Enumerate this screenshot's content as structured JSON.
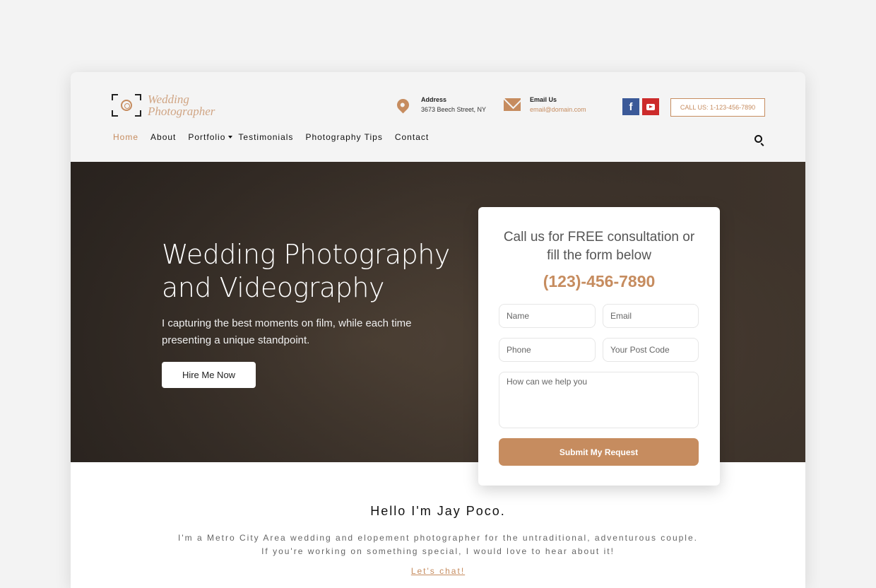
{
  "brand": {
    "line1": "Wedding",
    "line2": "Photographer"
  },
  "contact": {
    "address_title": "Address",
    "address": "3673 Beech Street, NY",
    "email_title": "Email Us",
    "email": "email@domain.com",
    "call_button": "CALL US: 1-123-456-7890"
  },
  "social": [
    {
      "icon": "facebook-icon",
      "label": "f"
    },
    {
      "icon": "youtube-icon"
    }
  ],
  "nav": [
    {
      "label": "Home",
      "active": true
    },
    {
      "label": "About"
    },
    {
      "label": "Portfolio",
      "dropdown": true
    },
    {
      "label": "Testimonials"
    },
    {
      "label": "Photography Tips"
    },
    {
      "label": "Contact"
    }
  ],
  "hero": {
    "title_line1": "Wedding Photography",
    "title_line2": "and Videography",
    "subtitle": "I capturing the best moments on film, while each time presenting a unique standpoint.",
    "cta": "Hire Me Now"
  },
  "form": {
    "heading_line1": "Call us for FREE consultation or",
    "heading_line2": "fill the form below",
    "phone": "(123)-456-7890",
    "name_placeholder": "Name",
    "email_placeholder": "Email",
    "phone_placeholder": "Phone",
    "postcode_placeholder": "Your Post Code",
    "message_placeholder": "How can we help you",
    "submit": "Submit My Request"
  },
  "about": {
    "title": "Hello I'm Jay Poco.",
    "text": "I'm a Metro City Area wedding and elopement photographer for the untraditional, adventurous couple. If you're working on something special, I would love to hear about it!",
    "link": "Let's chat!"
  },
  "colors": {
    "accent": "#c68c5f",
    "facebook": "#3b5998",
    "youtube": "#cc2b2b"
  }
}
